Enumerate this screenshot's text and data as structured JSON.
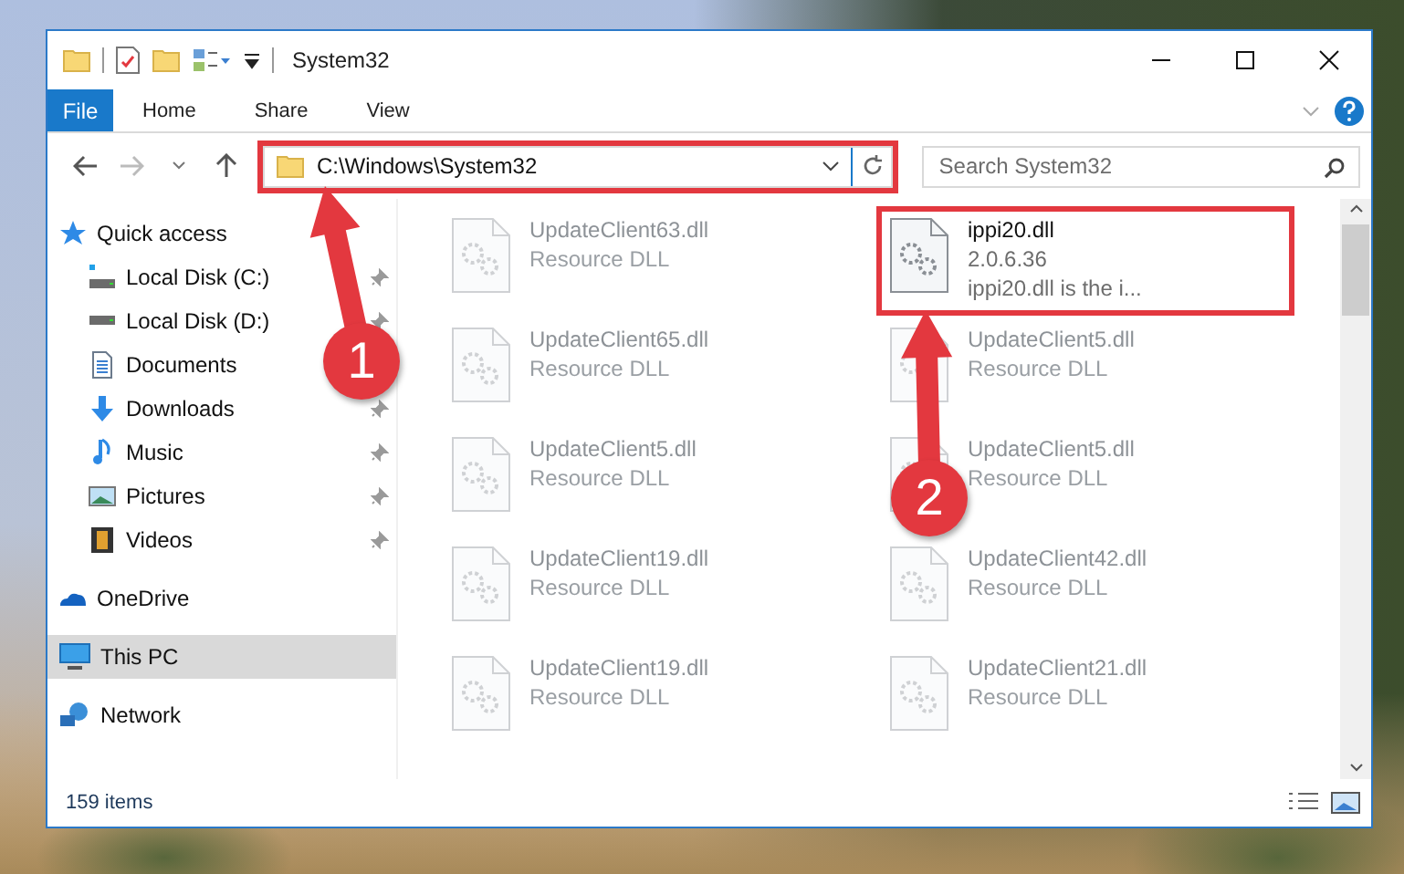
{
  "window": {
    "title": "System32"
  },
  "ribbon": {
    "file_tab": "File",
    "tabs": [
      "Home",
      "Share",
      "View"
    ]
  },
  "address_bar": {
    "path": "C:\\Windows\\System32",
    "highlighted": true
  },
  "search": {
    "placeholder": "Search System32"
  },
  "sidebar": {
    "items": [
      {
        "label": "Quick access",
        "selected": false,
        "children": [
          {
            "label": "Local Disk (C:)",
            "pinned": true,
            "selected": false
          },
          {
            "label": "Local Disk (D:)",
            "pinned": true,
            "selected": false
          },
          {
            "label": "Documents",
            "pinned": false,
            "selected": false
          },
          {
            "label": "Downloads",
            "pinned": true,
            "selected": false
          },
          {
            "label": "Music",
            "pinned": true,
            "selected": false
          },
          {
            "label": "Pictures",
            "pinned": true,
            "selected": false
          },
          {
            "label": "Videos",
            "pinned": true,
            "selected": false
          }
        ]
      },
      {
        "label": "OneDrive",
        "selected": false
      },
      {
        "label": "This PC",
        "selected": true
      },
      {
        "label": "Network",
        "selected": false
      }
    ]
  },
  "files": [
    {
      "name": "UpdateClient63.dll",
      "details": [
        "Resource DLL"
      ],
      "selected": false,
      "highlighted": false
    },
    {
      "name": "ippi20.dll",
      "details": [
        "2.0.6.36",
        "ippi20.dll is the i..."
      ],
      "selected": true,
      "highlighted": true
    },
    {
      "name": "UpdateClient65.dll",
      "details": [
        "Resource DLL"
      ],
      "selected": false,
      "highlighted": false
    },
    {
      "name": "UpdateClient5.dll",
      "details": [
        "Resource DLL"
      ],
      "selected": false,
      "highlighted": false
    },
    {
      "name": "UpdateClient5.dll",
      "details": [
        "Resource DLL"
      ],
      "selected": false,
      "highlighted": false
    },
    {
      "name": "UpdateClient5.dll",
      "details": [
        "Resource DLL"
      ],
      "selected": false,
      "highlighted": false
    },
    {
      "name": "UpdateClient19.dll",
      "details": [
        "Resource DLL"
      ],
      "selected": false,
      "highlighted": false
    },
    {
      "name": "UpdateClient42.dll",
      "details": [
        "Resource DLL"
      ],
      "selected": false,
      "highlighted": false
    },
    {
      "name": "UpdateClient19.dll",
      "details": [
        "Resource DLL"
      ],
      "selected": false,
      "highlighted": false
    },
    {
      "name": "UpdateClient21.dll",
      "details": [
        "Resource DLL"
      ],
      "selected": false,
      "highlighted": false
    }
  ],
  "status_bar": {
    "item_count": "159 items"
  },
  "callouts": [
    {
      "label": "1"
    },
    {
      "label": "2"
    }
  ]
}
